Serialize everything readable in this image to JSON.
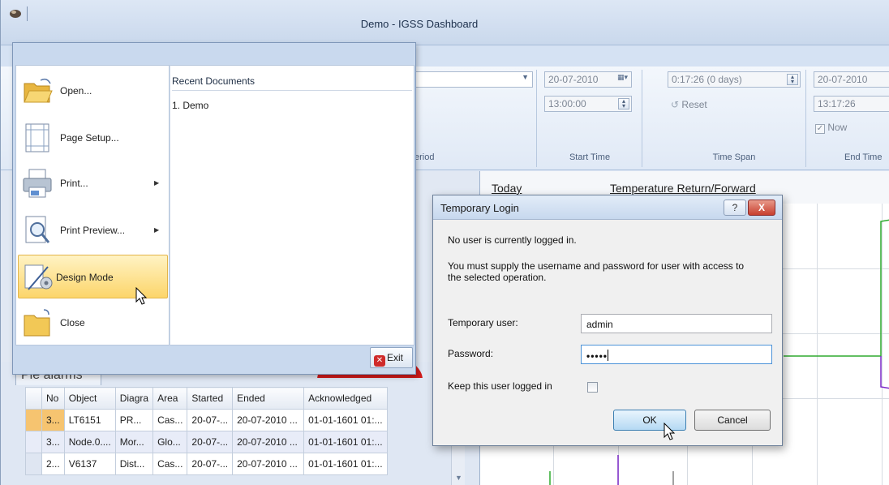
{
  "window": {
    "title": "Demo - IGSS Dashboard"
  },
  "ribbon": {
    "period_group_label": "eriod",
    "start_time": {
      "date": "20-07-2010",
      "time": "13:00:00",
      "group_label": "Start Time"
    },
    "time_span": {
      "value": "0:17:26 (0 days)",
      "reset_label": "Reset",
      "group_label": "Time Span"
    },
    "end_time": {
      "date": "20-07-2010",
      "time": "13:17:26",
      "now_label": "Now",
      "now_checked": true,
      "group_label": "End Time"
    }
  },
  "chart": {
    "header_left": "Today",
    "header_title": "Temperature Return/Forward"
  },
  "alarms": {
    "tab_label": "Pie alarms",
    "columns": [
      "No",
      "Object",
      "Diagra",
      "Area",
      "Started",
      "Ended",
      "Acknowledged"
    ],
    "rows": [
      [
        "3...",
        "LT6151",
        "PR...",
        "Cas...",
        "20-07-...",
        "20-07-2010 ...",
        "01-01-1601 01:..."
      ],
      [
        "3...",
        "Node.0....",
        "Mor...",
        "Glo...",
        "20-07-...",
        "20-07-2010 ...",
        "01-01-1601 01:..."
      ],
      [
        "2...",
        "V6137",
        "Dist...",
        "Cas...",
        "20-07-...",
        "20-07-2010 ...",
        "01-01-1601 01:..."
      ]
    ]
  },
  "app_menu": {
    "items": [
      {
        "label": "Open...",
        "icon": "folder-open-icon",
        "submenu": false
      },
      {
        "label": "Page Setup...",
        "icon": "page-setup-icon",
        "submenu": false
      },
      {
        "label": "Print...",
        "icon": "printer-icon",
        "submenu": true
      },
      {
        "label": "Print Preview...",
        "icon": "print-preview-icon",
        "submenu": true
      },
      {
        "label": "Design Mode",
        "icon": "design-mode-icon",
        "submenu": false,
        "highlighted": true
      },
      {
        "label": "Close",
        "icon": "folder-close-icon",
        "submenu": false
      }
    ],
    "recent_title": "Recent Documents",
    "recent_items": [
      "1. Demo"
    ],
    "exit_label": "Exit"
  },
  "dialog": {
    "title": "Temporary Login",
    "help_label": "?",
    "close_label": "X",
    "message1": "No user is currently logged in.",
    "message2": "You must supply the username and password for user with access to the selected operation.",
    "user_label": "Temporary user:",
    "user_value": "admin",
    "password_label": "Password:",
    "password_value": "•••••",
    "keep_label": "Keep this user logged in",
    "keep_checked": false,
    "ok_label": "OK",
    "cancel_label": "Cancel"
  }
}
